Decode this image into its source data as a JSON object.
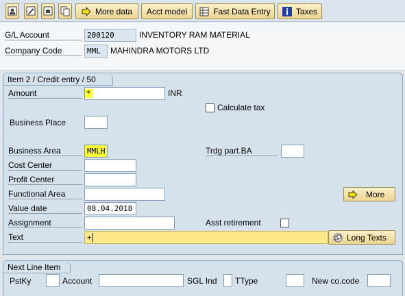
{
  "toolbar": {
    "icons": [
      "display-icon",
      "edit-icon",
      "document-icon",
      "copy-icon"
    ],
    "more_data": "More data",
    "acct_model": "Acct model",
    "fast_data_entry": "Fast Data Entry",
    "taxes": "Taxes"
  },
  "header": {
    "gl_account_label": "G/L Account",
    "gl_account_value": "200120",
    "gl_account_desc": "INVENTORY RAM MATERIAL",
    "company_code_label": "Company Code",
    "company_code_value": "MML",
    "company_code_desc": "MAHINDRA MOTORS LTD"
  },
  "item": {
    "title": "Item 2 / Credit entry / 50",
    "amount_label": "Amount",
    "amount_value": "*",
    "currency": "INR",
    "calculate_tax_label": "Calculate tax",
    "business_place_label": "Business Place",
    "business_area_label": "Business Area",
    "business_area_value": "MMLH",
    "trdg_part_label": "Trdg part.BA",
    "cost_center_label": "Cost Center",
    "profit_center_label": "Profit Center",
    "functional_area_label": "Functional Area",
    "more_label": "More",
    "value_date_label": "Value date",
    "value_date_value": "08.04.2018",
    "assignment_label": "Assignment",
    "asst_retirement_label": "Asst retirement",
    "text_label": "Text",
    "text_value": "+",
    "long_texts_label": "Long Texts"
  },
  "next_line": {
    "title": "Next Line Item",
    "pstky_label": "PstKy",
    "account_label": "Account",
    "sgl_ind_label": "SGL Ind",
    "ttype_label": "TType",
    "new_co_code_label": "New co.code"
  }
}
